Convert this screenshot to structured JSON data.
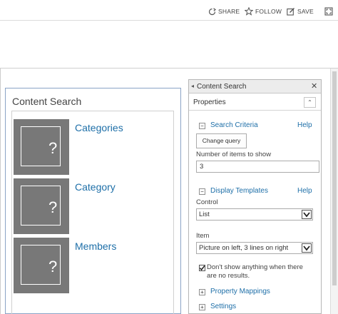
{
  "actions": {
    "share_label": "SHARE",
    "follow_label": "FOLLOW",
    "save_label": "SAVE"
  },
  "webpart": {
    "title": "Content Search",
    "results": [
      {
        "title": "Categories",
        "thumb_mark": "?"
      },
      {
        "title": "Category",
        "thumb_mark": "?"
      },
      {
        "title": "Members",
        "thumb_mark": "?"
      }
    ]
  },
  "toolpane": {
    "back_arrow": "◂",
    "title": "Content Search",
    "close_glyph": "✕",
    "properties_label": "Properties",
    "collapse_glyph": "⌃",
    "search_criteria": {
      "toggle": "−",
      "title": "Search Criteria",
      "help": "Help",
      "change_query_label": "Change query",
      "items_label": "Number of items to show",
      "items_value": "3"
    },
    "display_templates": {
      "toggle": "−",
      "title": "Display Templates",
      "help": "Help",
      "control_label": "Control",
      "control_value": "List",
      "item_label": "Item",
      "item_value": "Picture on left, 3 lines on right"
    },
    "dont_show_label": "Don't show anything when there are no results.",
    "dont_show_checked": true,
    "property_mappings": {
      "toggle": "+",
      "title": "Property Mappings"
    },
    "settings": {
      "toggle": "+",
      "title": "Settings"
    }
  },
  "colors": {
    "link": "#1e6fa8",
    "thumb_bg": "#787878",
    "webpart_border": "#8aa3c6"
  }
}
